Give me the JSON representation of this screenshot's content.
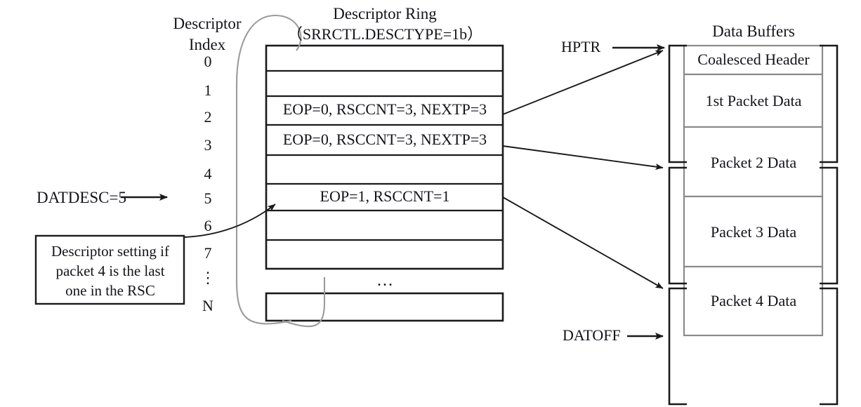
{
  "diagram": {
    "type": "block-diagram",
    "title_descriptor_index": [
      "Descriptor",
      "Index"
    ],
    "ring": {
      "title": "Descriptor Ring",
      "subtitle": "（SRRCTL.DESCTYPE=1b）",
      "ellipsis": "…",
      "indices": [
        "0",
        "1",
        "2",
        "3",
        "4",
        "5",
        "6",
        "7",
        "⋮",
        "N"
      ],
      "rows": [
        {
          "index": "0",
          "text": ""
        },
        {
          "index": "1",
          "text": ""
        },
        {
          "index": "2",
          "text": "EOP=0, RSCCNT=3, NEXTP=3"
        },
        {
          "index": "3",
          "text": "EOP=0, RSCCNT=3, NEXTP=3"
        },
        {
          "index": "4",
          "text": ""
        },
        {
          "index": "5",
          "text": "EOP=1, RSCCNT=1"
        },
        {
          "index": "6",
          "text": ""
        },
        {
          "index": "7",
          "text": ""
        },
        {
          "index": "N",
          "text": ""
        }
      ]
    },
    "buffers": {
      "title": "Data Buffers",
      "sections": [
        {
          "label": "Coalesced Header"
        },
        {
          "label": "1st Packet Data"
        },
        {
          "label": "Packet 2 Data"
        },
        {
          "label": "Packet 3 Data"
        },
        {
          "label": "Packet 4 Data"
        },
        {
          "label": ""
        }
      ]
    },
    "labels": {
      "datdesc": "DATDESC=5",
      "hptr": "HPTR",
      "datoff": "DATOFF"
    },
    "note": {
      "lines": [
        "Descriptor setting if",
        "packet 4 is the last",
        "one in the RSC"
      ]
    },
    "colors": {
      "stroke": "#1a1a1a",
      "inner_stroke": "#8a8a8a",
      "loop": "#9b9b9b",
      "background": "#ffffff"
    }
  }
}
